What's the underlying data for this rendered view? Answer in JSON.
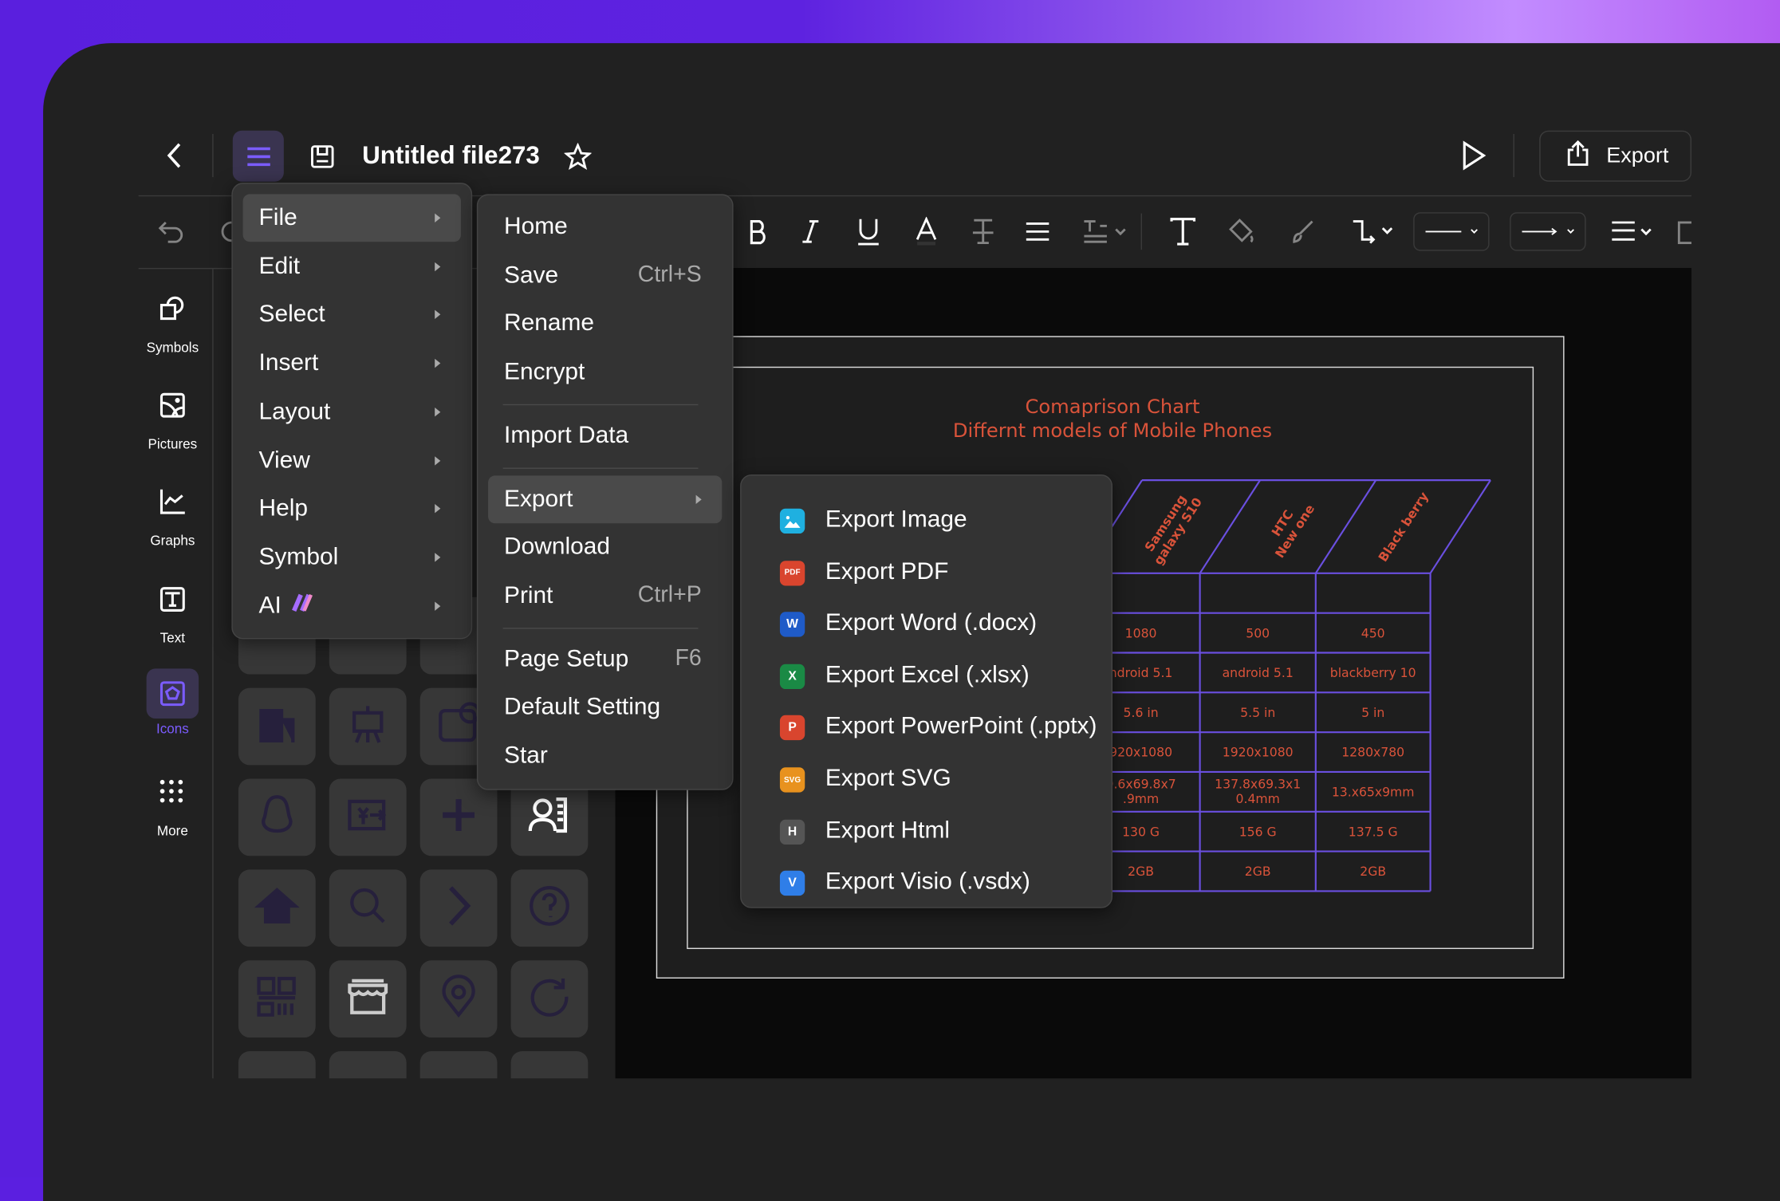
{
  "header": {
    "title": "Untitled file273",
    "export_label": "Export",
    "icons": [
      "back-chevron-icon",
      "menu-icon",
      "save-icon",
      "star-icon",
      "play-icon",
      "share-export-icon"
    ]
  },
  "toolbar": {
    "icons": [
      "undo-icon",
      "redo-icon",
      "bold-icon",
      "italic-icon",
      "underline-icon",
      "font-color-icon",
      "strikethrough-text-icon",
      "align-icon",
      "line-spacing-icon",
      "text-icon",
      "fill-icon",
      "brush-icon",
      "connector-icon",
      "line-style-icon",
      "arrow-style-icon",
      "line-weight-icon",
      "copy-style-icon"
    ]
  },
  "sidebar": {
    "items": [
      {
        "label": "Symbols"
      },
      {
        "label": "Pictures"
      },
      {
        "label": "Graphs"
      },
      {
        "label": "Text"
      },
      {
        "label": "Icons",
        "active": true
      },
      {
        "label": "More"
      }
    ]
  },
  "icon_panel": {
    "icons": [
      "building",
      "easel",
      "camera-coin",
      "qq-penguin",
      "payment",
      "plus",
      "contact-card",
      "home",
      "search",
      "chevron-right",
      "help",
      "qr-code",
      "store",
      "location-pin",
      "refresh"
    ]
  },
  "main_menu": {
    "items": [
      {
        "label": "File",
        "highlighted": true
      },
      {
        "label": "Edit"
      },
      {
        "label": "Select"
      },
      {
        "label": "Insert"
      },
      {
        "label": "Layout"
      },
      {
        "label": "View"
      },
      {
        "label": "Help"
      },
      {
        "label": "Symbol"
      },
      {
        "label": "AI"
      }
    ]
  },
  "file_menu": {
    "items": [
      {
        "label": "Home"
      },
      {
        "label": "Save",
        "shortcut": "Ctrl+S"
      },
      {
        "label": "Rename"
      },
      {
        "label": "Encrypt",
        "sep": true
      },
      {
        "label": "Import Data",
        "sep": true
      },
      {
        "label": "Export",
        "highlighted": true,
        "submenu": true
      },
      {
        "label": "Download"
      },
      {
        "label": "Print",
        "shortcut": "Ctrl+P",
        "sep": true
      },
      {
        "label": "Page Setup",
        "shortcut": "F6"
      },
      {
        "label": "Default Setting"
      },
      {
        "label": "Star"
      }
    ]
  },
  "export_menu": {
    "items": [
      {
        "label": "Export Image",
        "badge": "",
        "color": "#1fb0e0"
      },
      {
        "label": "Export PDF",
        "badge": "PDF",
        "color": "#d9452e"
      },
      {
        "label": "Export Word (.docx)",
        "badge": "W",
        "color": "#1f5bc8"
      },
      {
        "label": "Export Excel (.xlsx)",
        "badge": "X",
        "color": "#1a8a45"
      },
      {
        "label": "Export PowerPoint (.pptx)",
        "badge": "P",
        "color": "#d9452e"
      },
      {
        "label": "Export SVG",
        "badge": "SVG",
        "color": "#e8921e"
      },
      {
        "label": "Export Html",
        "badge": "H",
        "color": "#555555"
      },
      {
        "label": "Export Visio (.vsdx)",
        "badge": "V",
        "color": "#2f7ee8"
      }
    ]
  },
  "document": {
    "title": "Comaprison Chart",
    "subtitle": "Differnt models of Mobile Phones",
    "text_color": "#d9533a",
    "grid_color": "#6a4fe0",
    "columns": [
      "Samsung galaxy S10",
      "HTC New one",
      "Black berry"
    ],
    "rows": [
      [
        "",
        "",
        ""
      ],
      [
        "1080",
        "500",
        "450"
      ],
      [
        "ndroid 5.1",
        "android 5.1",
        "blackberry 10"
      ],
      [
        "5.6 in",
        "5.5 in",
        "5 in"
      ],
      [
        "920x1080",
        "1920x1080",
        "1280x780"
      ],
      [
        "9.6x69.8x7 .9mm",
        "137.8x69.3x1 0.4mm",
        "13.x65x9mm"
      ],
      [
        "130 G",
        "156 G",
        "137.5 G"
      ],
      [
        "2GB",
        "2GB",
        "2GB"
      ]
    ]
  },
  "colors": {
    "accent": "#6b4fe8",
    "panel": "#212121",
    "menu": "#333333"
  }
}
